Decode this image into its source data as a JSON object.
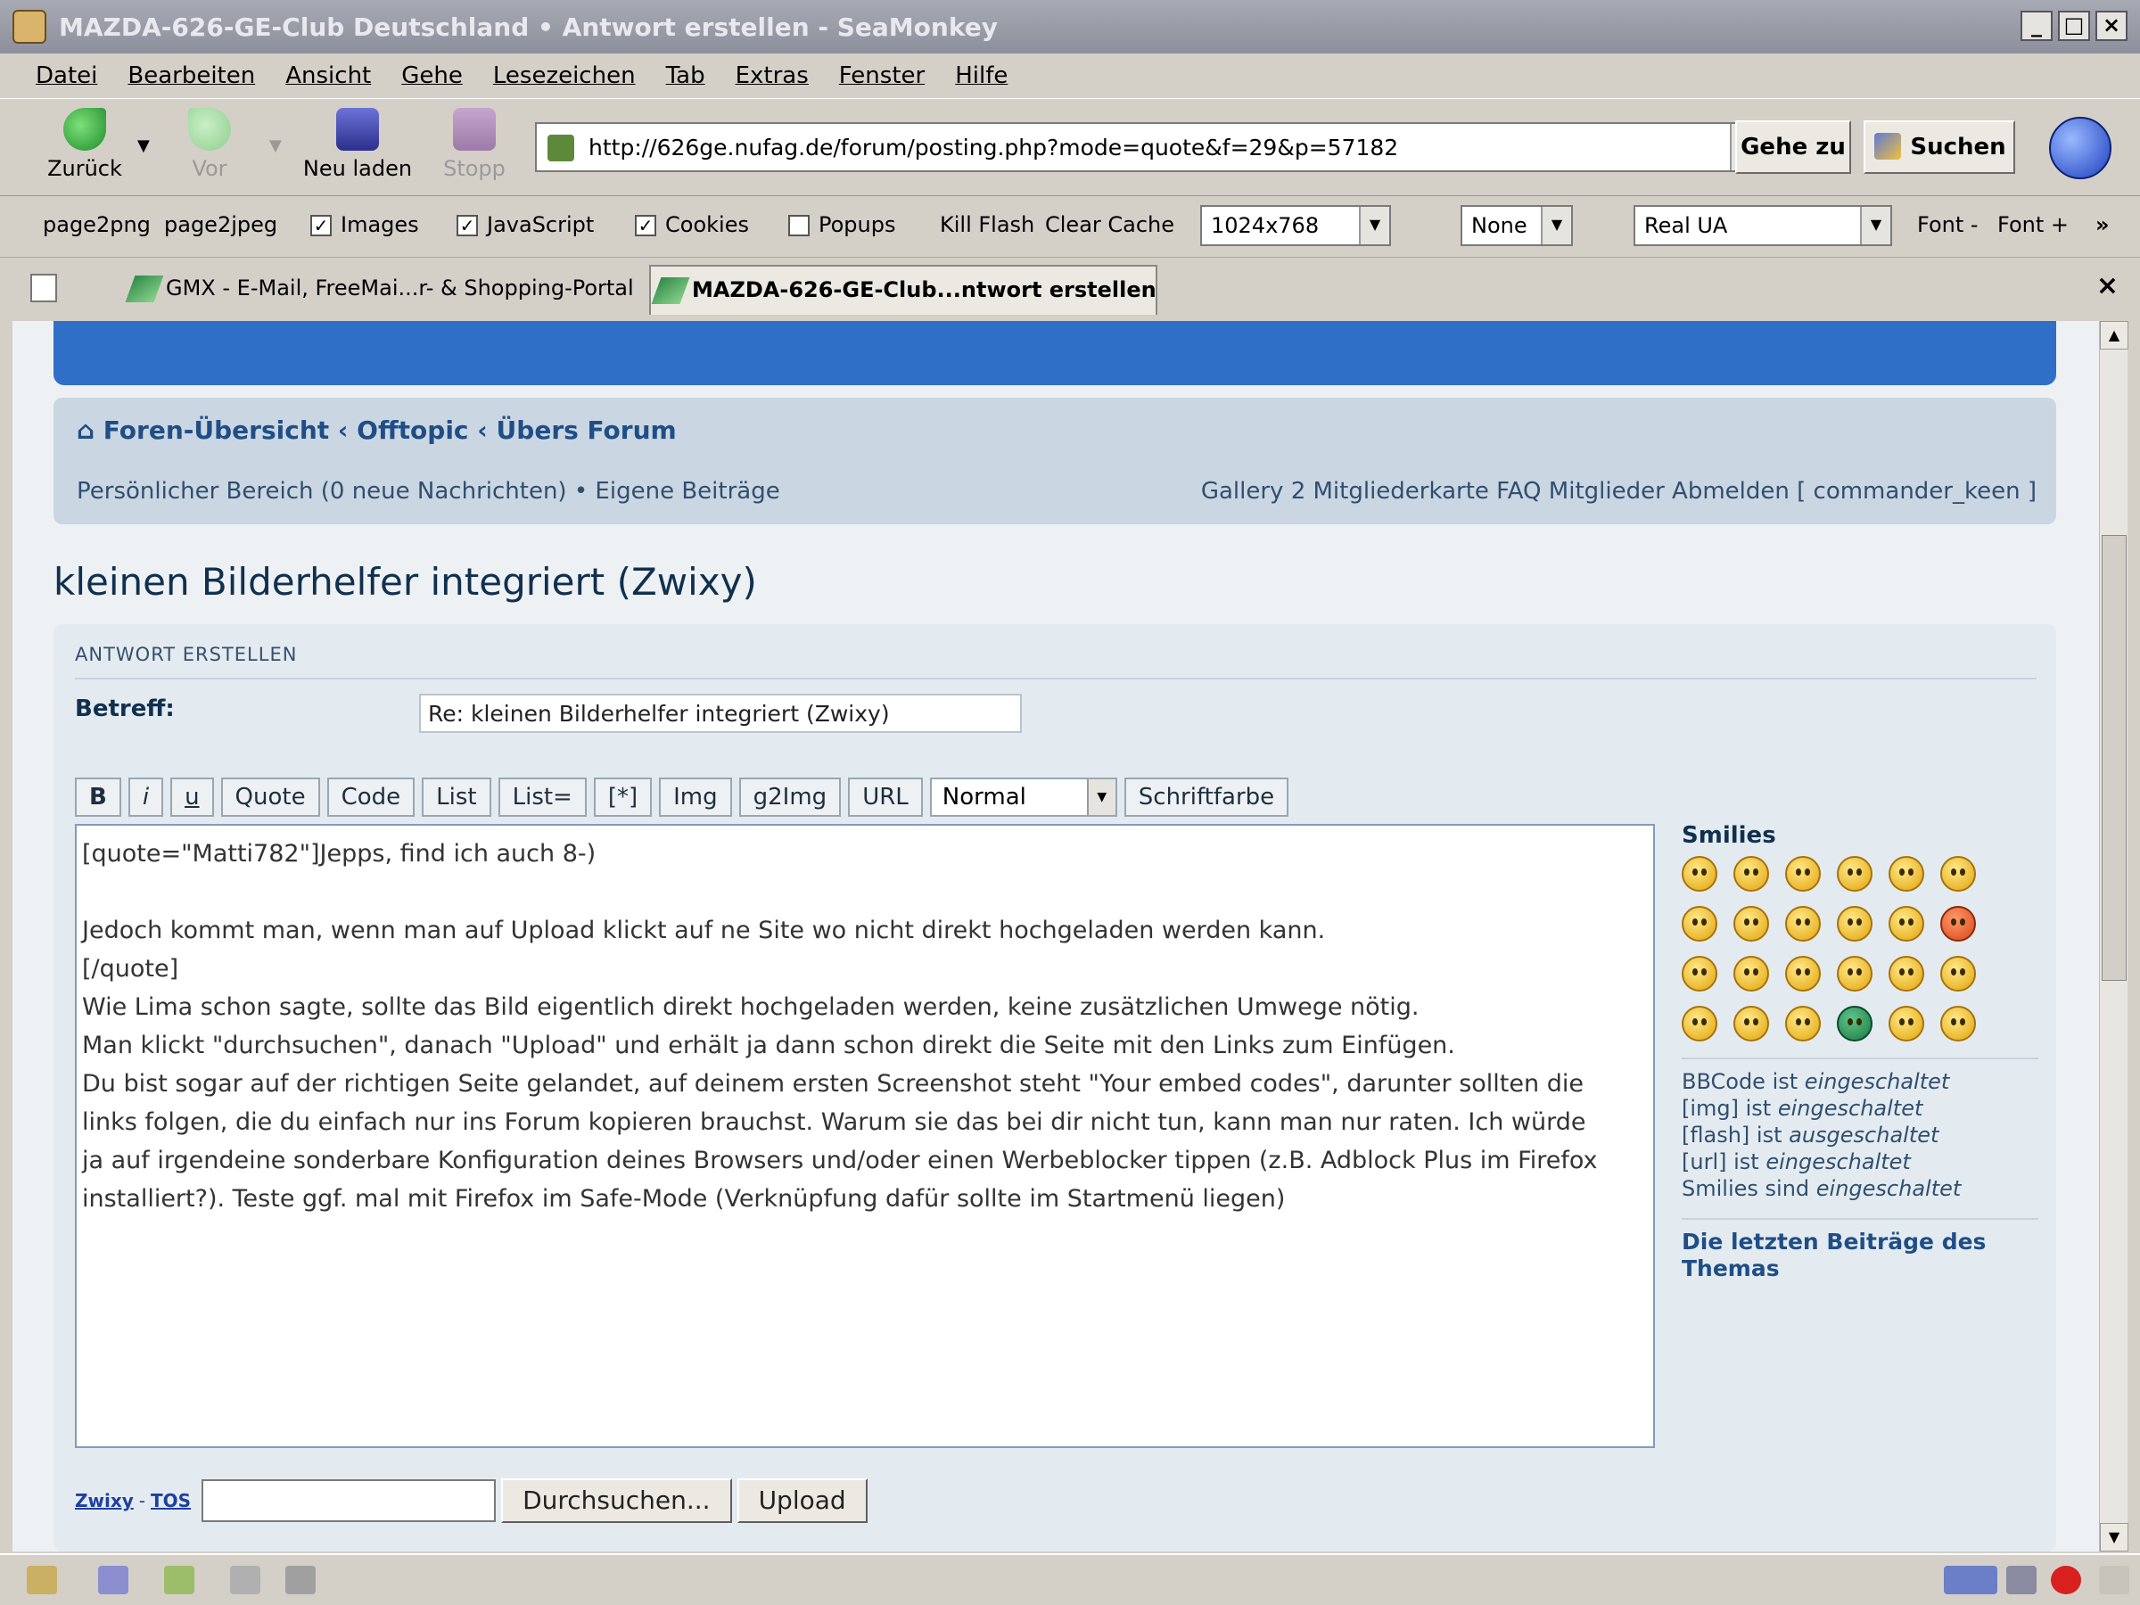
{
  "window": {
    "title": "MAZDA-626-GE-Club Deutschland • Antwort erstellen - SeaMonkey",
    "buttons": {
      "minimize": "_",
      "maximize": "□",
      "close": "×"
    }
  },
  "menu": [
    "Datei",
    "Bearbeiten",
    "Ansicht",
    "Gehe",
    "Lesezeichen",
    "Tab",
    "Extras",
    "Fenster",
    "Hilfe"
  ],
  "nav": {
    "back": "Zurück",
    "forward": "Vor",
    "reload": "Neu laden",
    "stop": "Stopp",
    "url": "http://626ge.nufag.de/forum/posting.php?mode=quote&f=29&p=57182",
    "go": "Gehe zu",
    "search": "Suchen"
  },
  "ext": {
    "page2png": "page2png",
    "page2jpeg": "page2jpeg",
    "images": "Images",
    "javascript": "JavaScript",
    "cookies": "Cookies",
    "popups": "Popups",
    "killflash": "Kill Flash",
    "clearcache": "Clear Cache",
    "resolution": "1024x768",
    "proxy": "None",
    "ua": "Real UA",
    "font_minus": "Font -",
    "font_plus": "Font +",
    "more": "»",
    "check": "✓"
  },
  "tabs": [
    {
      "label": "GMX - E-Mail, FreeMai...r- & Shopping-Portal"
    },
    {
      "label": "MAZDA-626-GE-Club...ntwort erstellen"
    }
  ],
  "tab_close": "×",
  "forum": {
    "breadcrumb": "⌂ Foren-Übersicht ‹ Offtopic ‹ Übers Forum",
    "links_left": "Persönlicher Bereich (0 neue Nachrichten) • Eigene Beiträge",
    "links_right": "Gallery 2  Mitgliederkarte  FAQ  Mitglieder  Abmelden [ commander_keen ]",
    "page_title": "kleinen Bilderhelfer integriert (Zwixy)",
    "section_title": "ANTWORT ERSTELLEN",
    "subject_label": "Betreff:",
    "subject_value": "Re: kleinen Bilderhelfer integriert (Zwixy)",
    "bbcode_buttons": [
      "B",
      "i",
      "u",
      "Quote",
      "Code",
      "List",
      "List=",
      "[*]",
      "Img",
      "g2Img",
      "URL"
    ],
    "font_size": "Normal",
    "font_color": "Schriftfarbe",
    "smilies_title": "Smilies",
    "bbcode_info": [
      {
        "pre": "BBCode ist ",
        "state": "eingeschaltet"
      },
      {
        "pre": "[img] ist ",
        "state": "eingeschaltet"
      },
      {
        "pre": "[flash] ist ",
        "state": "ausgeschaltet"
      },
      {
        "pre": "[url] ist ",
        "state": "eingeschaltet"
      },
      {
        "pre": "Smilies sind ",
        "state": "eingeschaltet"
      }
    ],
    "recent_posts": "Die letzten Beiträge des Themas",
    "upload_link1": "Zwixy",
    "upload_link2": "TOS",
    "upload_sep": "-",
    "browse": "Durchsuchen...",
    "upload": "Upload"
  },
  "message_lines": [
    "[quote=\"Matti782\"]Jepps, find ich auch  8-)",
    "",
    "Jedoch kommt man, wenn man auf Upload klickt auf ne Site wo nicht direkt hochgeladen werden kann.",
    "[/quote]",
    "Wie Lima schon sagte, sollte das Bild eigentlich direkt hochgeladen werden, keine zusätzlichen Umwege nötig.",
    "Man klickt \"durchsuchen\", danach \"Upload\" und erhält ja dann schon direkt die Seite mit den Links zum Einfügen.",
    "Du bist sogar auf der richtigen Seite gelandet, auf deinem ersten Screenshot steht \"Your embed codes\", darunter sollten die",
    "links folgen, die du einfach nur ins Forum kopieren brauchst. Warum sie das bei dir nicht tun, kann man nur raten. Ich würde",
    "ja auf irgendeine sonderbare Konfiguration deines Browsers und/oder einen Werbeblocker tippen (z.B. Adblock Plus im Firefox",
    "installiert?). Teste ggf. mal mit Firefox im Safe-Mode (Verknüpfung dafür sollte im Startmenü liegen)"
  ]
}
